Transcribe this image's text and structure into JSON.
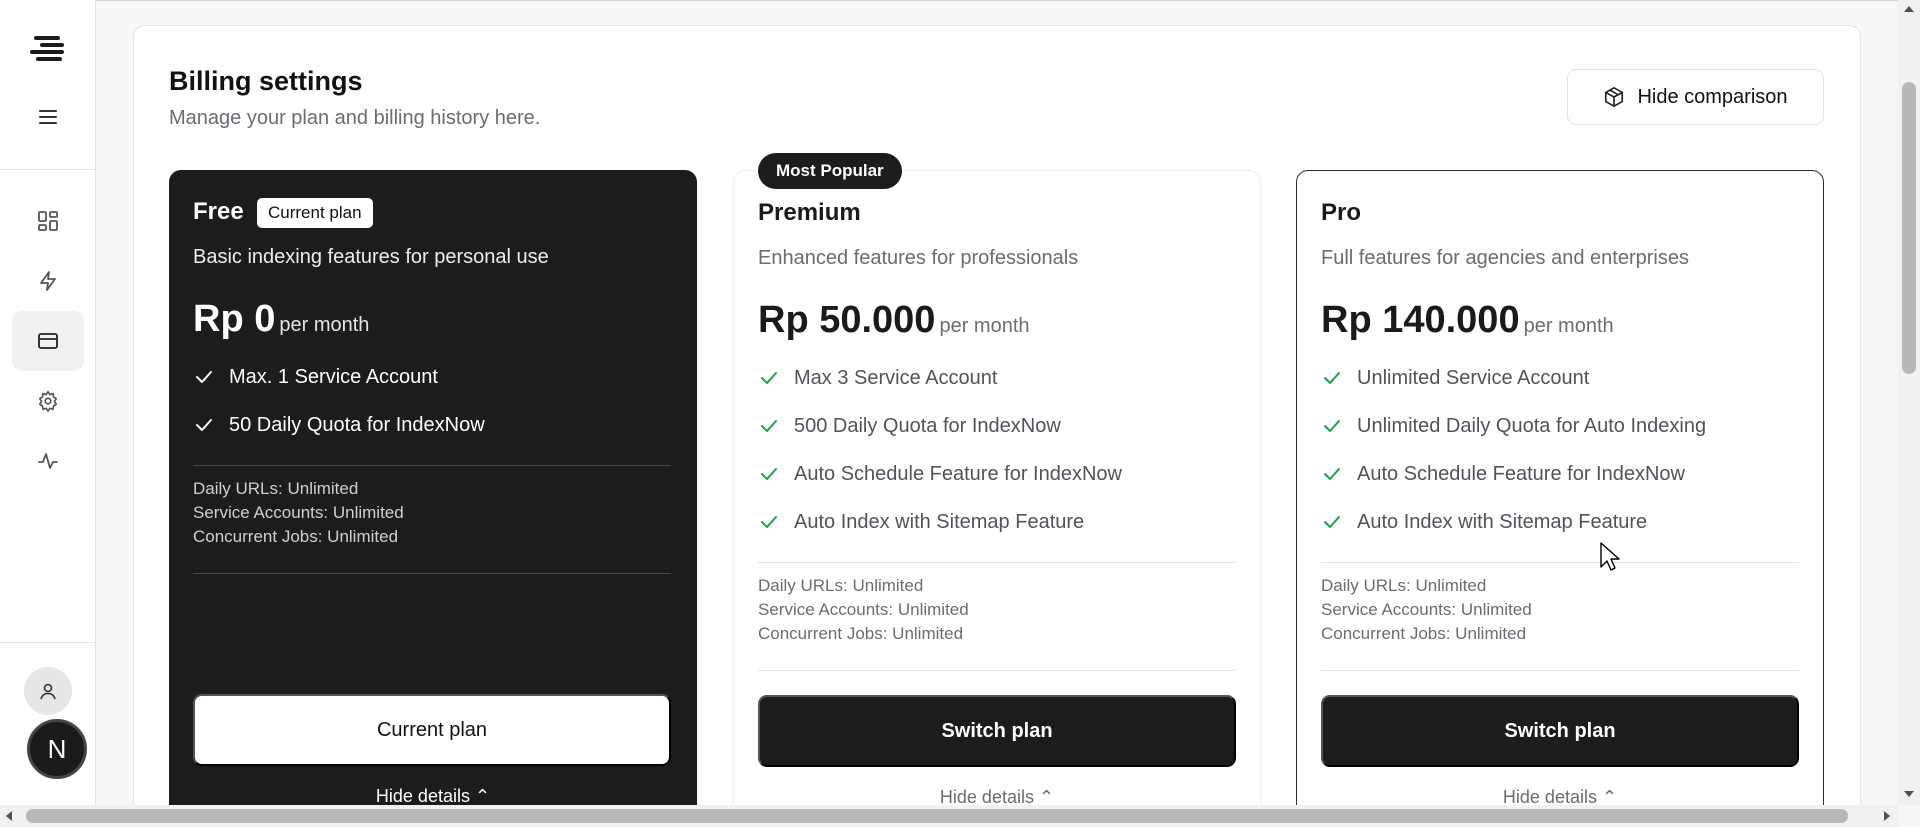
{
  "header": {
    "title": "Billing settings",
    "subtitle": "Manage your plan and billing history here.",
    "toggle_label": "Hide comparison"
  },
  "sidebar": {
    "items": [
      {
        "icon": "dashboard-icon",
        "active": false
      },
      {
        "icon": "lightning-icon",
        "active": false
      },
      {
        "icon": "credit-card-icon",
        "active": true
      },
      {
        "icon": "gear-icon",
        "active": false
      },
      {
        "icon": "activity-icon",
        "active": false
      }
    ],
    "user_initial": "N"
  },
  "plans": [
    {
      "name": "Free",
      "badge": "Current plan",
      "description": "Basic indexing features for personal use",
      "price": "Rp 0",
      "period": "per month",
      "features": [
        "Max. 1 Service Account",
        "50 Daily Quota for IndexNow"
      ],
      "limits": [
        "Daily URLs: Unlimited",
        "Service Accounts: Unlimited",
        "Concurrent Jobs: Unlimited"
      ],
      "cta": "Current plan",
      "details": "Hide details"
    },
    {
      "name": "Premium",
      "tag": "Most Popular",
      "description": "Enhanced features for professionals",
      "price": "Rp 50.000",
      "period": "per month",
      "features": [
        "Max 3 Service Account",
        "500 Daily Quota for IndexNow",
        "Auto Schedule Feature for IndexNow",
        "Auto Index with Sitemap Feature"
      ],
      "limits": [
        "Daily URLs: Unlimited",
        "Service Accounts: Unlimited",
        "Concurrent Jobs: Unlimited"
      ],
      "cta": "Switch plan",
      "details": "Hide details"
    },
    {
      "name": "Pro",
      "description": "Full features for agencies and enterprises",
      "price": "Rp 140.000",
      "period": "per month",
      "features": [
        "Unlimited Service Account",
        "Unlimited Daily Quota for Auto Indexing",
        "Auto Schedule Feature for IndexNow",
        "Auto Index with Sitemap Feature"
      ],
      "limits": [
        "Daily URLs: Unlimited",
        "Service Accounts: Unlimited",
        "Concurrent Jobs: Unlimited"
      ],
      "cta": "Switch plan",
      "details": "Hide details"
    }
  ],
  "colors": {
    "dark": "#1c1c1c",
    "check_green": "#16a34a",
    "muted_text": "#6b6b73"
  }
}
